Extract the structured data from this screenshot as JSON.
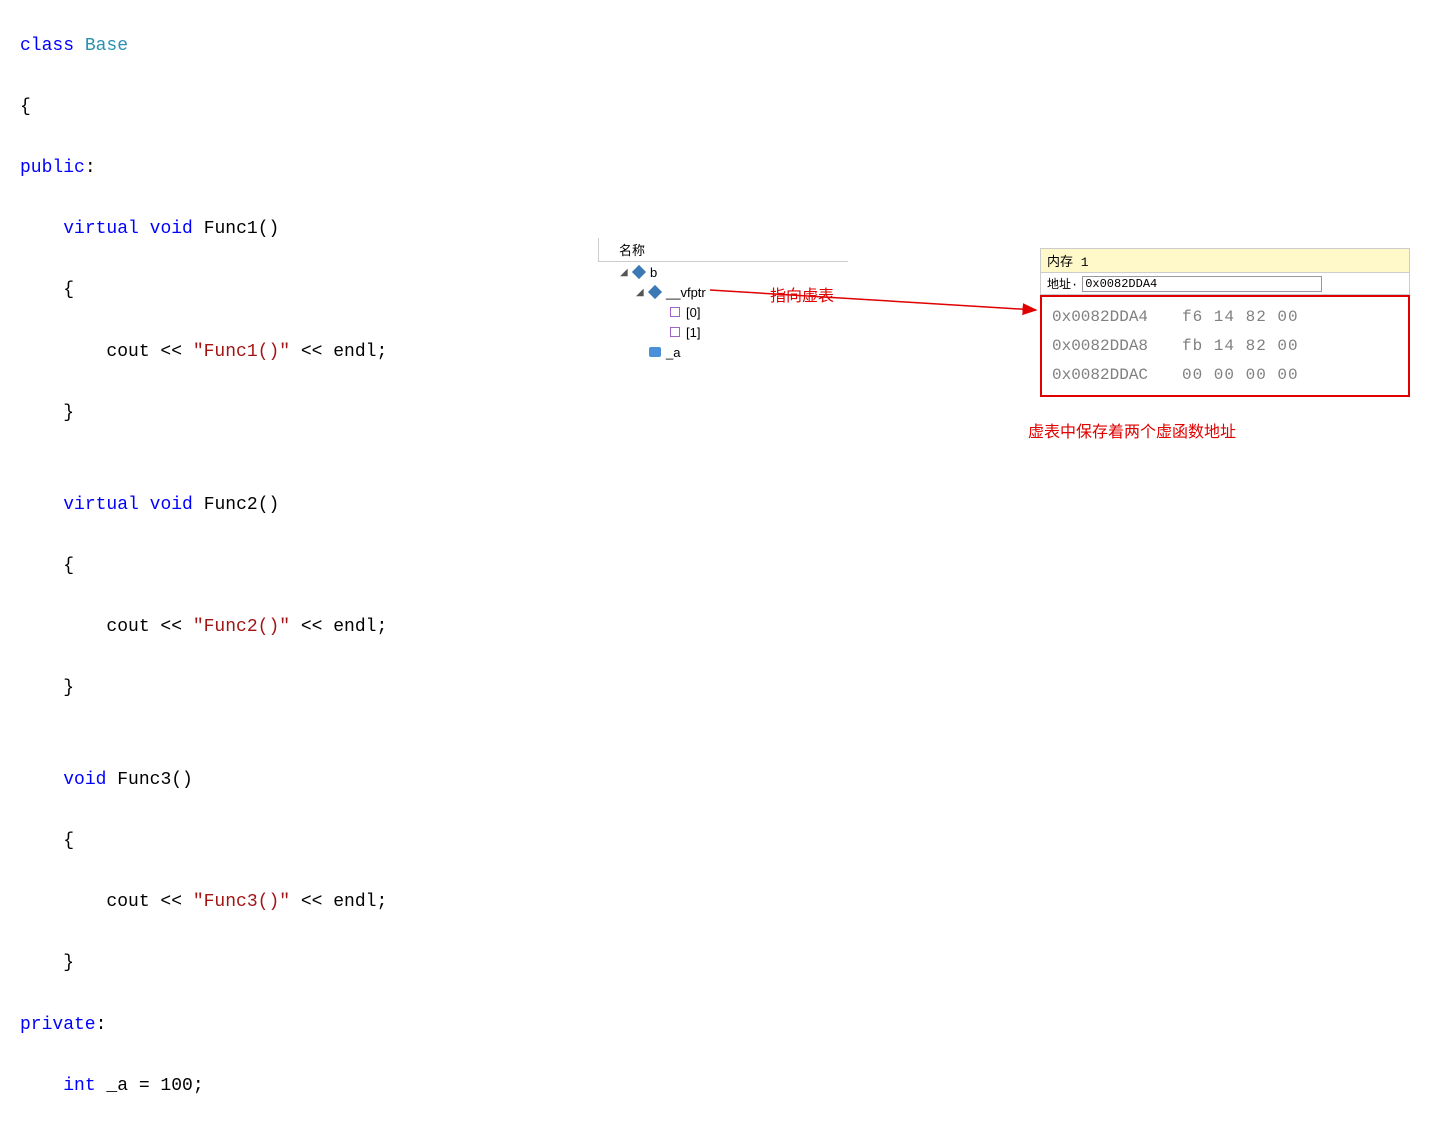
{
  "code": {
    "l1": {
      "kw1": "class",
      "type": "Base"
    },
    "l2": "{",
    "l3": {
      "kw": "public",
      "colon": ":"
    },
    "l4": {
      "kw1": "virtual",
      "kw2": "void",
      "name": "Func1()"
    },
    "l5": "    {",
    "l6": {
      "pre": "        cout << ",
      "str": "\"Func1()\"",
      "post": " << endl;"
    },
    "l7": "    }",
    "l8": "",
    "l9": {
      "kw1": "virtual",
      "kw2": "void",
      "name": "Func2()"
    },
    "l10": "    {",
    "l11": {
      "pre": "        cout << ",
      "str": "\"Func2()\"",
      "post": " << endl;"
    },
    "l12": "    }",
    "l13": "",
    "l14": {
      "kw1": "void",
      "name": "Func3()"
    },
    "l15": "    {",
    "l16": {
      "pre": "        cout << ",
      "str": "\"Func3()\"",
      "post": " << endl;"
    },
    "l17": "    }",
    "l18": {
      "kw": "private",
      "colon": ":"
    },
    "l19": {
      "kw1": "int",
      "name": " _a = 100;"
    }
  },
  "watch": {
    "header": "名称",
    "b": "b",
    "vfptr": "__vfptr",
    "idx0": "[0]",
    "idx1": "[1]",
    "field_a": "_a"
  },
  "memory": {
    "title": "内存 1",
    "addr_label": "地址·",
    "addr_value": "0x0082DDA4",
    "rows": [
      {
        "addr": "0x0082DDA4",
        "bytes": "f6 14 82 00"
      },
      {
        "addr": "0x0082DDA8",
        "bytes": "fb 14 82 00"
      },
      {
        "addr": "0x0082DDAC",
        "bytes": "00 00 00 00"
      }
    ]
  },
  "annotations": {
    "a1": "指向虚表",
    "a2": "虚表中保存着两个虚函数地址"
  }
}
